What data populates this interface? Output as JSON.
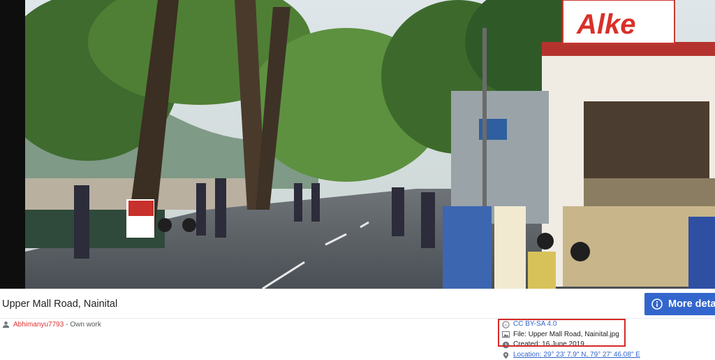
{
  "image": {
    "title": "Upper Mall Road, Nainital",
    "sign_text": "Alke",
    "alt": "Street photo of Upper Mall Road, Nainital"
  },
  "toolbar": {
    "more_details_label": "More deta"
  },
  "author": {
    "name": "Abhimanyu7793",
    "suffix": "- Own work"
  },
  "meta": {
    "license": "CC BY-SA 4.0",
    "file_label": "File:",
    "file_name": "Upper Mall Road, Nainital.jpg",
    "created_label": "Created:",
    "created_date": "16 June 2019",
    "location_label": "Location:",
    "location_value": "29° 23′ 7.9″ N, 79° 27′ 46.08″ E"
  },
  "colors": {
    "accent": "#3366cc",
    "highlight": "#d42a2a",
    "author_link": "#d33"
  }
}
